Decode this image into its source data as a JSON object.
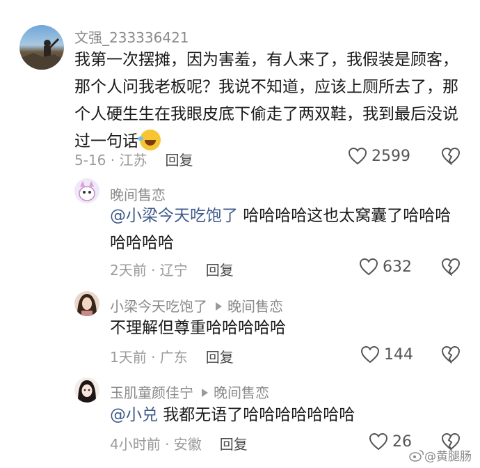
{
  "comments": [
    {
      "username": "文强_233336421",
      "text": "我第一次摆摊，因为害羞，有人来了，我假装是顾客，那个人问我老板呢？我说不知道，应该上厕所去了，那个人硬生生在我眼皮底下偷走了两双鞋，我到最后没说过一句话",
      "emoji": "rolling-on-floor-laughing-emoji",
      "date_location": "5-16 · 江苏",
      "reply_label": "回复",
      "likes": "2599"
    }
  ],
  "replies": [
    {
      "username": "晚间售恋",
      "mention": "@小梁今天吃饱了",
      "text": " 哈哈哈哈这也太窝囊了哈哈哈哈哈哈哈",
      "date_location": "2天前 · 辽宁",
      "reply_label": "回复",
      "likes": "632"
    },
    {
      "username": "小梁今天吃饱了",
      "reply_to": "晚间售恋",
      "text": "不理解但尊重哈哈哈哈哈",
      "date_location": "1天前 · 广东",
      "reply_label": "回复",
      "likes": "144"
    },
    {
      "username": "玉肌童颜佳宁",
      "reply_to": "晚间售恋",
      "mention": "@小兑",
      "text": " 我都无语了哈哈哈哈哈哈哈",
      "date_location": "4小时前 · 安徽",
      "reply_label": "回复",
      "likes": "26"
    }
  ],
  "watermark": "@黄腿肠",
  "colors": {
    "mention": "#3d5a8a",
    "meta": "#9a9a9a",
    "name": "#8a8a8a"
  }
}
